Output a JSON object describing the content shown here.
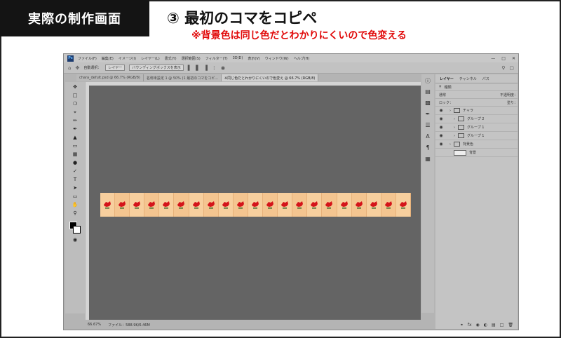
{
  "badge": "実際の制作画面",
  "heading": "③ 最初のコマをコピペ",
  "note": "※背景色は同じ色だとわかりにくいので色変える",
  "app": {
    "logo": "Ps",
    "menu": [
      "ファイル(F)",
      "編集(E)",
      "イメージ(I)",
      "レイヤー(L)",
      "書式(Y)",
      "選択範囲(S)",
      "フィルター(T)",
      "3D(D)",
      "表示(V)",
      "ウィンドウ(W)",
      "ヘルプ(H)"
    ],
    "options": {
      "auto_select": "自動選択：",
      "layer_select": "レイヤー",
      "bbox": "バウンディングボックスを表示"
    },
    "tabs": [
      "chara_defult.psd @ 66.7% (RGB/8)",
      "名称未設定 1 @ 50% (1 最初のコマをコピ...",
      "※同じ色だとわかりにくいので色変え @ 66.7% (RGB/8)"
    ],
    "status": {
      "zoom": "66.67%",
      "file": "ファイル：588.9K/6.46M"
    },
    "frame_count": 21
  },
  "layers_panel": {
    "tabs": [
      "レイヤー",
      "チャンネル",
      "パス"
    ],
    "filter": "種類",
    "blend_mode": "通常",
    "opacity_label": "不透明度：",
    "lock_label": "ロック：",
    "fill_label": "塗り：",
    "layers": [
      {
        "name": "チャラ",
        "type": "group",
        "indent": 0
      },
      {
        "name": "グループ 2",
        "type": "group",
        "indent": 1
      },
      {
        "name": "グループ 1",
        "type": "group",
        "indent": 1
      },
      {
        "name": "グループ 1",
        "type": "group",
        "indent": 1
      },
      {
        "name": "背景色",
        "type": "group",
        "indent": 0
      },
      {
        "name": "背景",
        "type": "layer",
        "indent": 1
      }
    ]
  },
  "colors": {
    "badge_bg": "#141414",
    "note": "#e10a0a",
    "canvas": "#646464",
    "frame_light": "#f7cf9e",
    "frame_dark": "#f4c590",
    "sprite": "#d4141a"
  }
}
